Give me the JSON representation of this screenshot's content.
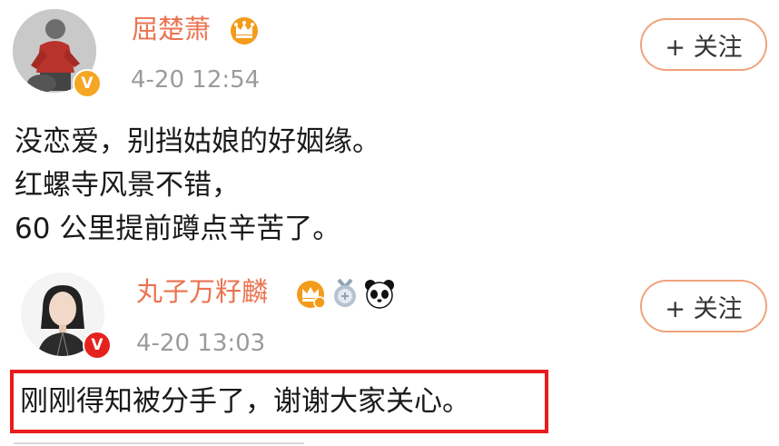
{
  "posts": [
    {
      "username": "屈楚萧",
      "badge_icons": [
        "crown-vip-icon"
      ],
      "verified": "V",
      "timestamp": "4-20 12:54",
      "follow_label": "+ 关注",
      "lines": [
        "没恋爱，别挡姑娘的好姻缘。",
        "红螺寺风景不错，",
        "60 公里提前蹲点辛苦了。"
      ]
    },
    {
      "username": "丸子万籽麟",
      "badge_icons": [
        "crown-vip-icon",
        "medal-icon",
        "panda-icon"
      ],
      "verified": "V",
      "timestamp": "4-20 13:03",
      "follow_label": "+ 关注",
      "lines": [
        "刚刚得知被分手了，谢谢大家关心。"
      ]
    }
  ],
  "colors": {
    "username": "#eb7350",
    "timestamp": "#9b9b9b",
    "follow_border": "#f0a37c",
    "verified_badge": "#f5a623",
    "verified_badge_red": "#e5221d",
    "highlight_box": "#e81c1c"
  }
}
